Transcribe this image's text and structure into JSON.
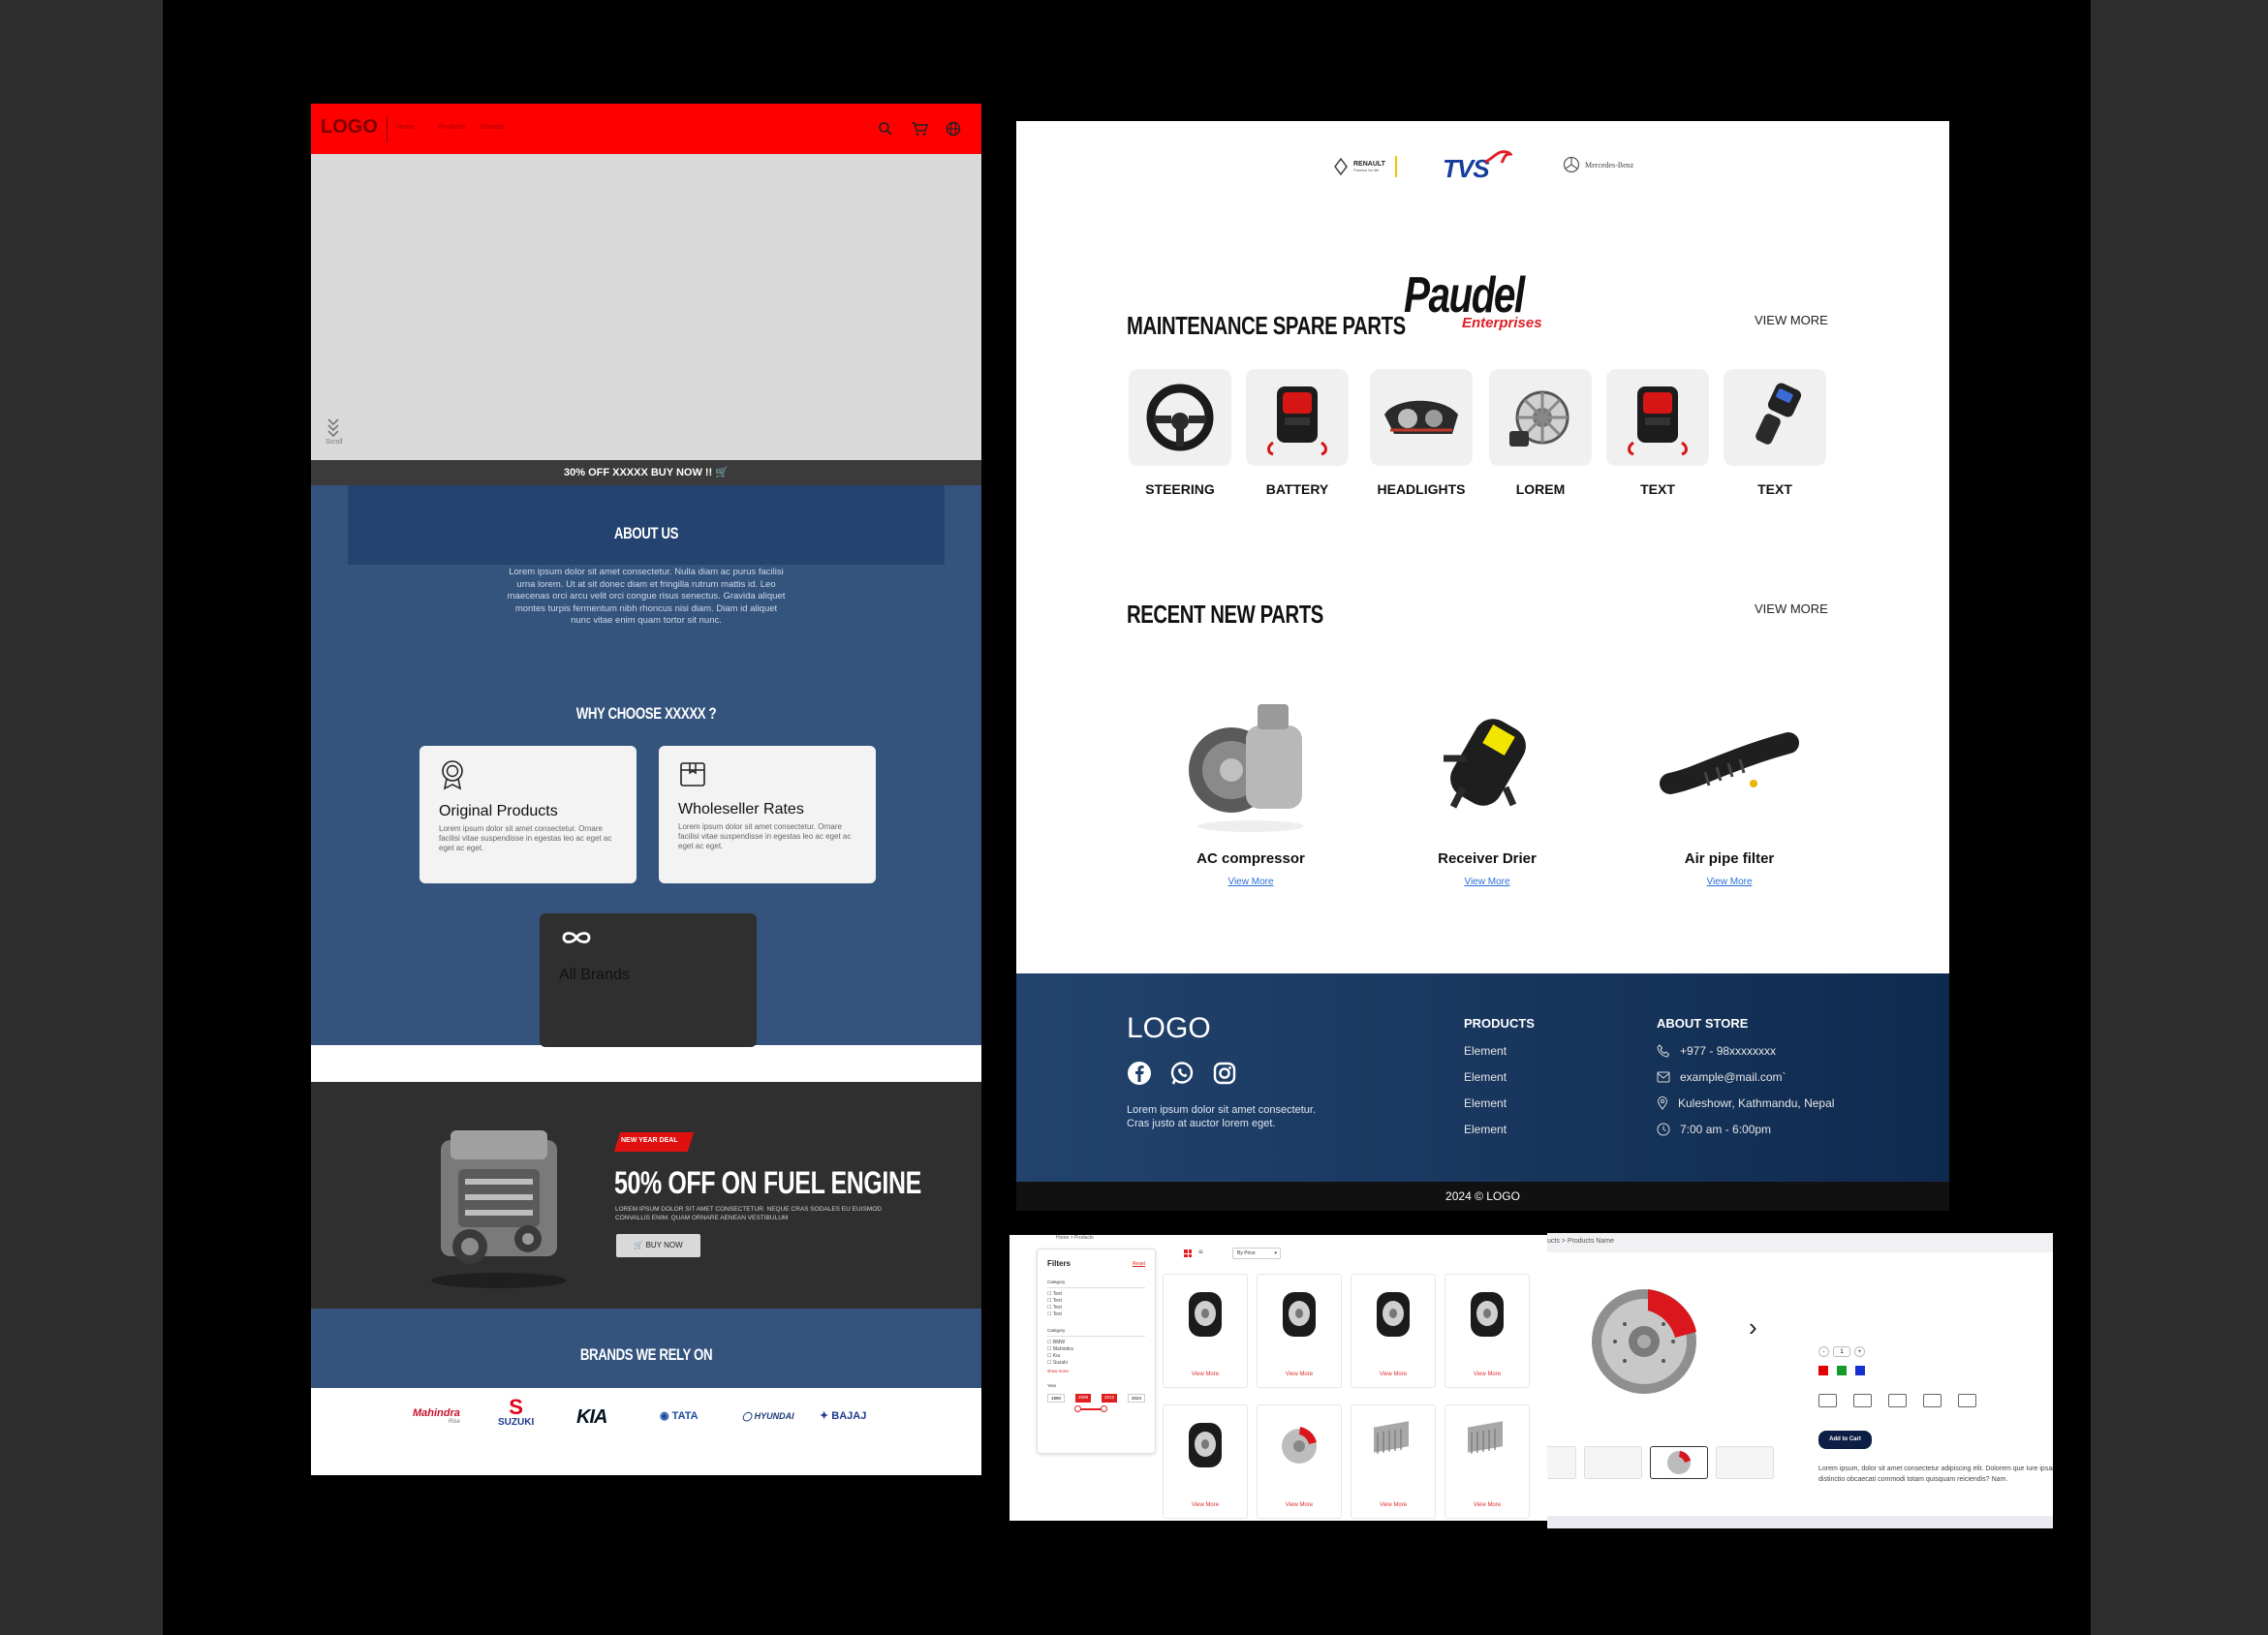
{
  "home": {
    "nav": {
      "logo": "LOGO",
      "links": [
        "Home",
        "Products",
        "Contact"
      ]
    },
    "hero": {
      "scroll_label": "Scroll"
    },
    "promo_text": "30% OFF XXXXX BUY NOW !!",
    "about": {
      "title": "ABOUT US",
      "body": "Lorem ipsum dolor sit amet consectetur. Nulla diam ac purus facilisi urna lorem. Ut at sit donec diam et fringilla rutrum mattis id. Leo maecenas orci arcu velit orci congue risus senectus. Gravida aliquet montes turpis fermentum nibh rhoncus nisi diam. Diam id aliquet nunc vitae enim quam tortor sit nunc."
    },
    "why": {
      "title": "WHY CHOOSE  XXXXX ?",
      "cards": [
        {
          "title": "Original Products",
          "body": "Lorem ipsum dolor sit amet consectetur. Ornare facilisi vitae suspendisse in egestas leo ac eget ac eget ac eget."
        },
        {
          "title": "Wholeseller Rates",
          "body": "Lorem ipsum dolor sit amet consectetur. Ornare facilisi vitae suspendisse in egestas leo ac eget ac eget ac eget."
        },
        {
          "title": "All Brands",
          "body": ""
        }
      ]
    },
    "deal": {
      "tag": "NEW YEAR DEAL",
      "title": "50% OFF ON FUEL ENGINE",
      "body": "LOREM IPSUM DOLOR SIT AMET CONSECTETUR. NEQUE CRAS SODALES EU EUISMOD CONVALLIS ENIM. QUAM ORNARE AENEAN VESTIBULUM",
      "button": "BUY NOW"
    },
    "brands": {
      "title": "BRANDS WE RELY ON",
      "items": [
        "Mahindra",
        "SUZUKI",
        "KIA",
        "TATA",
        "HYUNDAI",
        "BAJAJ"
      ],
      "mahindra_sub": "Rise"
    }
  },
  "landing": {
    "partner_logos": [
      "RENAULT",
      "TVS",
      "Mercedes-Benz"
    ],
    "renault_sub": "Passion for life",
    "brand_logo": {
      "name": "Paudel",
      "sub": "Enterprises"
    },
    "maintenance": {
      "title": "MAINTENANCE SPARE PARTS",
      "view_more": "VIEW MORE",
      "items": [
        "STEERING",
        "BATTERY",
        "HEADLIGHTS",
        "LOREM",
        "TEXT",
        "TEXT"
      ]
    },
    "recent": {
      "title": "RECENT NEW PARTS",
      "view_more": "VIEW MORE",
      "items": [
        {
          "name": "AC compressor",
          "link": "View More"
        },
        {
          "name": "Receiver Drier",
          "link": "View More"
        },
        {
          "name": "Air pipe filter",
          "link": "View More"
        }
      ]
    },
    "footer": {
      "logo": "LOGO",
      "tagline": "Lorem ipsum dolor sit amet consectetur. Cras justo at auctor lorem eget.",
      "products_title": "PRODUCTS",
      "products": [
        "Element",
        "Element",
        "Element",
        "Element"
      ],
      "about_title": "ABOUT STORE",
      "phone": "+977 - 98xxxxxxxx",
      "email": "example@mail.com`",
      "address": "Kuleshowr, Kathmandu, Nepal",
      "hours": "7:00 am - 6:00pm",
      "copyright": "2024 © LOGO"
    }
  },
  "listing": {
    "breadcrumb": "Home  >  Products",
    "sort": "By Price",
    "filters": {
      "title": "Filters",
      "reset": "Reset",
      "category1": "Category",
      "opts1": [
        "Text",
        "Text",
        "Text",
        "Text"
      ],
      "category2": "Category",
      "opts2": [
        "BMW",
        "Mahindra",
        "Kia",
        "Suzuki"
      ],
      "show_more": "show more",
      "year_label": "Year",
      "years": [
        "1990",
        "2009",
        "2012",
        "2024"
      ]
    },
    "tile_link": "View More"
  },
  "detail": {
    "breadcrumb": "ucts  >  Products Name",
    "qty": "1",
    "colors": [
      "#e10000",
      "#149a2a",
      "#1530d0"
    ],
    "add_to_cart": "Add to Cart",
    "description": "Lorem ipsum, dolor sit amet consectetur adipiscing elit. Dolorem que Iure ipsam distinctio obcaecati commodi totam quisquam reiciendis? Nam."
  }
}
